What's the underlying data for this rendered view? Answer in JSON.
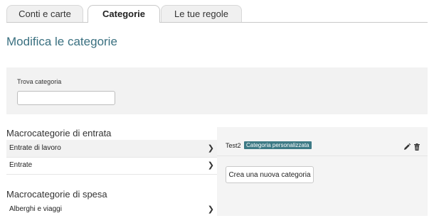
{
  "tabs": [
    {
      "label": "Conti e carte",
      "active": false
    },
    {
      "label": "Categorie",
      "active": true
    },
    {
      "label": "Le tue regole",
      "active": false
    }
  ],
  "page_title": "Modifica le categorie",
  "search": {
    "label": "Trova categoria",
    "value": "",
    "placeholder": ""
  },
  "income": {
    "title": "Macrocategorie di entrata",
    "items": [
      {
        "label": "Entrate di lavoro",
        "selected": true
      },
      {
        "label": "Entrate",
        "selected": false
      }
    ]
  },
  "expense": {
    "title": "Macrocategorie di spesa",
    "items": [
      {
        "label": "Alberghi e viaggi",
        "selected": false
      }
    ]
  },
  "detail": {
    "category_name": "Test2",
    "badge": "Categoria personalizzata",
    "new_button": "Crea una nuova categoria"
  },
  "icons": {
    "chevron": "chevron-right-icon",
    "edit": "pencil-icon",
    "delete": "trash-icon"
  },
  "colors": {
    "accent": "#3a7080",
    "badge_bg": "#3d7a85",
    "panel_bg": "#f2f2f2"
  }
}
